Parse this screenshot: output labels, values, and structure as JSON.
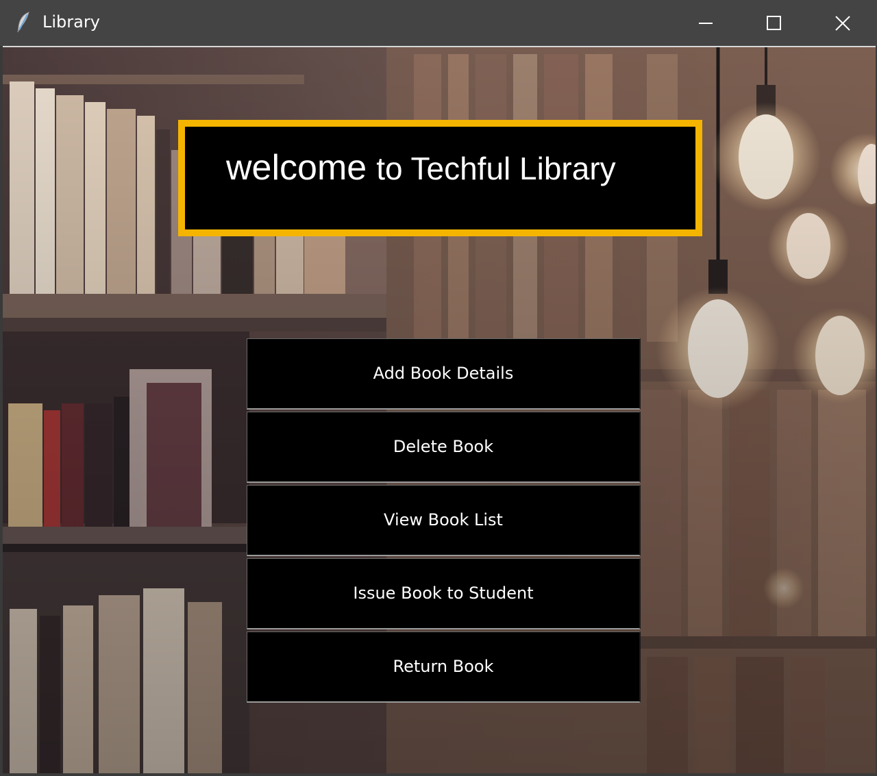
{
  "window": {
    "title": "Library",
    "icon": "feather-icon",
    "controls": [
      "minimize-icon",
      "maximize-icon",
      "close-icon"
    ]
  },
  "banner": {
    "word1": "welcome",
    "word2": "to Techful Library",
    "background_color": "#000000",
    "border_color": "#f4b400"
  },
  "menu": {
    "items": [
      {
        "label": "Add Book Details"
      },
      {
        "label": "Delete Book"
      },
      {
        "label": "View Book List"
      },
      {
        "label": "Issue Book to Student"
      },
      {
        "label": "Return Book"
      }
    ]
  },
  "colors": {
    "titlebar": "#444444",
    "button_bg": "#000000",
    "button_text": "#ffffff"
  }
}
